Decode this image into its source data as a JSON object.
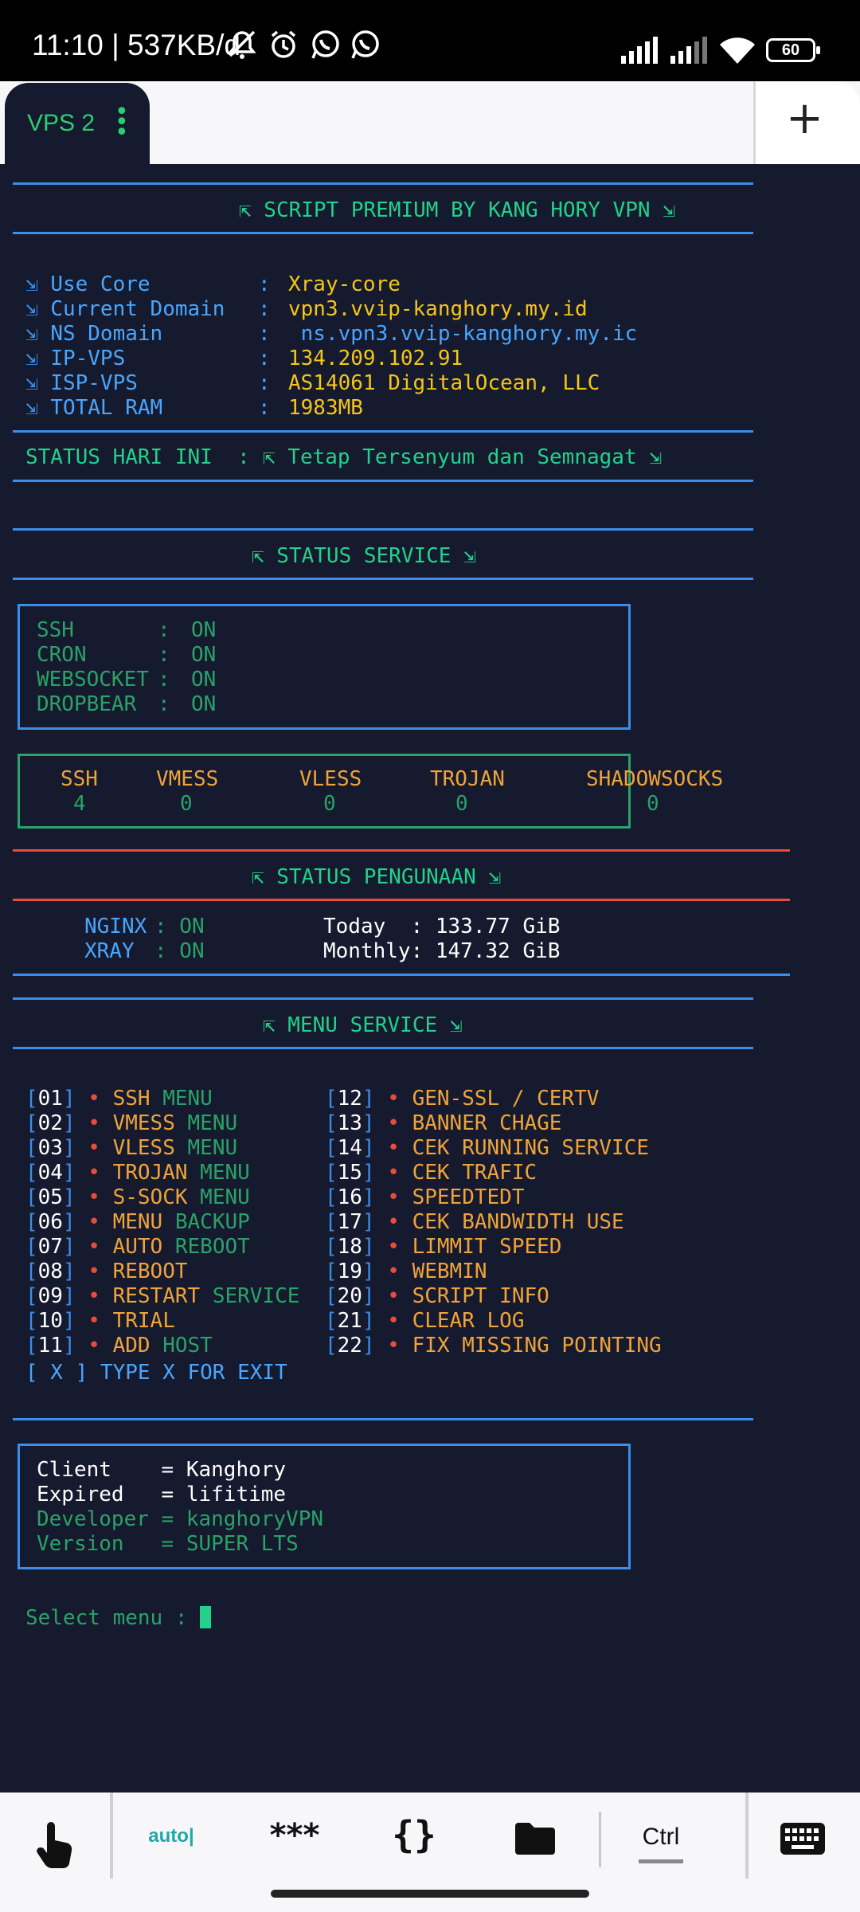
{
  "status_bar": {
    "time": "11:10 | 537KB/d",
    "battery": "60",
    "icons": [
      "bell-off-icon",
      "alarm-icon",
      "whatsapp-icon",
      "whatsapp-icon",
      "signal-icon",
      "signal-icon",
      "wifi-icon",
      "battery-icon"
    ]
  },
  "tabs": {
    "active_tab": "VPS 2",
    "menu_icon": "vertical-dots-icon",
    "add_icon": "plus-icon"
  },
  "terminal": {
    "banner_title": "⇱ SCRIPT PREMIUM BY KANG HORY VPN ⇲",
    "info": [
      {
        "arrow": "⇲",
        "label": "Use Core      ",
        "sep": ":",
        "value": "Xray-core"
      },
      {
        "arrow": "⇲",
        "label": "Current Domain",
        "sep": ":",
        "value": "vpn3.vvip-kanghory.my.id"
      },
      {
        "arrow": "⇲",
        "label": "NS Domain     ",
        "sep": ":",
        "value": " ns.vpn3.vvip-kanghory.my.ic"
      },
      {
        "arrow": "⇲",
        "label": "IP-VPS        ",
        "sep": ":",
        "value": "134.209.102.91"
      },
      {
        "arrow": "⇲",
        "label": "ISP-VPS       ",
        "sep": ":",
        "value": "AS14061 DigitalOcean, LLC"
      },
      {
        "arrow": "⇲",
        "label": "TOTAL RAM     ",
        "sep": ":",
        "value": "1983MB"
      }
    ],
    "status_today_label": "STATUS HARI INI  :",
    "status_today_value": "⇱ Tetap Tersenyum dan Semnagat ⇲",
    "status_service_title": "⇱ STATUS SERVICE ⇲",
    "services": [
      {
        "name": "SSH      ",
        "sep": ":",
        "state": "ON"
      },
      {
        "name": "CRON     ",
        "sep": ":",
        "state": "ON"
      },
      {
        "name": "WEBSOCKET",
        "sep": ":",
        "state": "ON"
      },
      {
        "name": "DROPBEAR ",
        "sep": ":",
        "state": "ON"
      }
    ],
    "accounts": [
      {
        "name": "SSH",
        "count": "4"
      },
      {
        "name": "VMESS",
        "count": "0"
      },
      {
        "name": "VLESS",
        "count": "0"
      },
      {
        "name": "TROJAN",
        "count": "0"
      },
      {
        "name": "SHADOWSOCKS",
        "count": "0"
      }
    ],
    "usage_title": "⇱ STATUS PENGUNAAN ⇲",
    "usage": {
      "nginx_label": "NGINX",
      "nginx_state": ": ON",
      "xray_label": "XRAY ",
      "xray_state": ": ON",
      "today": "Today  : 133.77 GiB",
      "monthly": "Monthly: 147.32 GiB"
    },
    "menu_title": "⇱ MENU SERVICE ⇲",
    "menu_left": [
      {
        "num": "01",
        "a": "SSH",
        "b": " MENU"
      },
      {
        "num": "02",
        "a": "VMESS",
        "b": " MENU"
      },
      {
        "num": "03",
        "a": "VLESS",
        "b": " MENU"
      },
      {
        "num": "04",
        "a": "TROJAN",
        "b": " MENU"
      },
      {
        "num": "05",
        "a": "S-SOCK",
        "b": " MENU"
      },
      {
        "num": "06",
        "a": "MENU",
        "b": " BACKUP"
      },
      {
        "num": "07",
        "a": "AUTO",
        "b": " REBOOT"
      },
      {
        "num": "08",
        "a": "REBOOT",
        "b": ""
      },
      {
        "num": "09",
        "a": "RESTART",
        "b": " SERVICE"
      },
      {
        "num": "10",
        "a": "TRIAL",
        "b": ""
      },
      {
        "num": "11",
        "a": "ADD",
        "b": " HOST"
      }
    ],
    "menu_right": [
      {
        "num": "12",
        "a": "GEN-SSL / CERTV"
      },
      {
        "num": "13",
        "a": "BANNER CHAGE"
      },
      {
        "num": "14",
        "a": "CEK RUNNING SERVICE"
      },
      {
        "num": "15",
        "a": "CEK TRAFIC"
      },
      {
        "num": "16",
        "a": "SPEEDTEDT"
      },
      {
        "num": "17",
        "a": "CEK BANDWIDTH USE"
      },
      {
        "num": "18",
        "a": "LIMMIT SPEED"
      },
      {
        "num": "19",
        "a": "WEBMIN"
      },
      {
        "num": "20",
        "a": "SCRIPT INFO"
      },
      {
        "num": "21",
        "a": "CLEAR LOG"
      },
      {
        "num": "22",
        "a": "FIX MISSING POINTING"
      }
    ],
    "exit_line": "[ X ] TYPE X FOR EXIT",
    "client_box": {
      "client": "Client    = Kanghory",
      "expired": "Expired   = lifitime",
      "developer": "Developer = kanghoryVPN",
      "version": "Version   = SUPER LTS"
    },
    "prompt": "Select menu : "
  },
  "extra_keys": {
    "touch_icon": "touch-hand-icon",
    "auto_label": "auto",
    "stars_label": "***",
    "braces_label": "{}",
    "folder_icon": "folder-icon",
    "ctrl_label": "Ctrl",
    "keyboard_icon": "keyboard-icon"
  },
  "colors": {
    "terminal_bg": "#151a2e",
    "blue": "#3b8eea",
    "green": "#23d18b",
    "yellow": "#f5c518",
    "orange": "#f0a33a",
    "red": "#e74c3c"
  }
}
